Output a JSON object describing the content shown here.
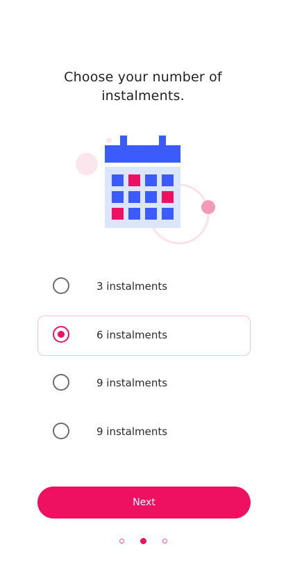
{
  "title_line1": "Choose your number of",
  "title_line2": "instalments.",
  "illustration_icon": "calendar-icon",
  "options": [
    {
      "label": "3 instalments",
      "selected": false
    },
    {
      "label": "6 instalments",
      "selected": true
    },
    {
      "label": "9 instalments",
      "selected": false
    },
    {
      "label": "9 instalments",
      "selected": false
    }
  ],
  "next_label": "Next",
  "pager": {
    "count": 3,
    "active_index": 1
  },
  "colors": {
    "accent": "#ee1161",
    "calendar_blue": "#3b5bfd",
    "calendar_bg": "#dbe6fb",
    "selected_border": "#f6c2d3"
  }
}
